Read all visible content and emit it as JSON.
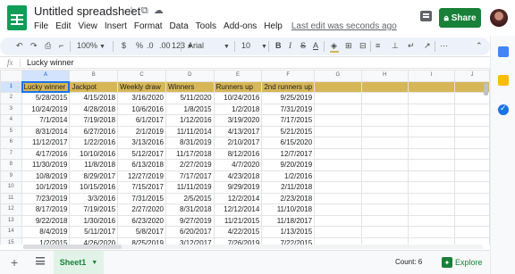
{
  "app": {
    "doc_title": "Untitled spreadsheet",
    "last_edit": "Last edit was seconds ago",
    "share_label": "Share",
    "menus": [
      "File",
      "Edit",
      "View",
      "Insert",
      "Format",
      "Data",
      "Tools",
      "Add-ons",
      "Help"
    ]
  },
  "toolbar": {
    "zoom": "100%",
    "currency": "$",
    "percent": "%",
    "dec_decrease": ".0",
    "dec_increase": ".00",
    "more_formats": "123",
    "font": "Arial",
    "font_size": "10"
  },
  "formula_bar": {
    "fx": "fx",
    "content": "Lucky winner"
  },
  "grid": {
    "columns": [
      "A",
      "B",
      "C",
      "D",
      "E",
      "F",
      "G",
      "H",
      "I",
      "J"
    ],
    "header_row": [
      "Lucky winner",
      "Jackpot",
      "Weekly draw",
      "Winners",
      "Runners up",
      "2nd runners up"
    ],
    "rows": [
      [
        "5/28/2015",
        "4/15/2018",
        "3/16/2020",
        "5/11/2020",
        "10/24/2016",
        "9/25/2019"
      ],
      [
        "10/24/2019",
        "4/28/2018",
        "10/6/2016",
        "1/8/2015",
        "1/2/2018",
        "7/31/2019"
      ],
      [
        "7/1/2014",
        "7/19/2018",
        "6/1/2017",
        "1/12/2016",
        "3/19/2020",
        "7/17/2015"
      ],
      [
        "8/31/2014",
        "6/27/2016",
        "2/1/2019",
        "11/11/2014",
        "4/13/2017",
        "5/21/2015"
      ],
      [
        "11/12/2017",
        "1/22/2016",
        "3/13/2016",
        "8/31/2019",
        "2/10/2017",
        "6/15/2020"
      ],
      [
        "4/17/2016",
        "10/10/2016",
        "5/12/2017",
        "11/17/2018",
        "8/12/2016",
        "12/7/2017"
      ],
      [
        "11/30/2019",
        "11/8/2018",
        "6/13/2018",
        "2/27/2019",
        "4/7/2020",
        "9/20/2019"
      ],
      [
        "10/8/2019",
        "8/29/2017",
        "12/27/2019",
        "7/17/2017",
        "4/23/2018",
        "1/2/2016"
      ],
      [
        "10/1/2019",
        "10/15/2016",
        "7/15/2017",
        "11/11/2019",
        "9/29/2019",
        "2/11/2018"
      ],
      [
        "7/23/2019",
        "3/3/2016",
        "7/31/2015",
        "2/5/2015",
        "12/2/2014",
        "2/23/2018"
      ],
      [
        "8/17/2019",
        "7/19/2015",
        "2/27/2020",
        "8/31/2018",
        "12/12/2014",
        "11/10/2018"
      ],
      [
        "9/22/2018",
        "1/30/2016",
        "6/23/2020",
        "9/27/2019",
        "11/21/2015",
        "11/18/2017"
      ],
      [
        "8/4/2019",
        "5/11/2017",
        "5/8/2017",
        "6/20/2017",
        "4/22/2015",
        "1/13/2015"
      ],
      [
        "1/2/2015",
        "4/26/2020",
        "8/25/2019",
        "3/12/2017",
        "7/26/2019",
        "7/22/2015"
      ]
    ]
  },
  "bottom": {
    "sheet_name": "Sheet1",
    "count": "Count: 6",
    "explore_label": "Explore"
  },
  "colors": {
    "header_fill": "#d6b656",
    "share_green": "#188038",
    "selection_blue": "#1a73e8"
  }
}
